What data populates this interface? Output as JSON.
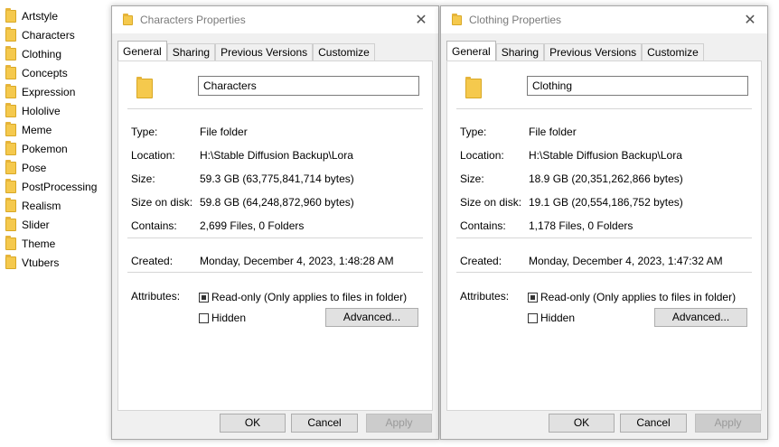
{
  "sidebar": {
    "items": [
      "Artstyle",
      "Characters",
      "Clothing",
      "Concepts",
      "Expression",
      "Hololive",
      "Meme",
      "Pokemon",
      "Pose",
      "PostProcessing",
      "Realism",
      "Slider",
      "Theme",
      "Vtubers"
    ]
  },
  "dialogs": [
    {
      "title": "Characters Properties",
      "tabs": [
        "General",
        "Sharing",
        "Previous Versions",
        "Customize"
      ],
      "name": "Characters",
      "type_label": "Type:",
      "type": "File folder",
      "location_label": "Location:",
      "location": "H:\\Stable Diffusion Backup\\Lora",
      "size_label": "Size:",
      "size": "59.3 GB (63,775,841,714 bytes)",
      "size_on_disk_label": "Size on disk:",
      "size_on_disk": "59.8 GB (64,248,872,960 bytes)",
      "contains_label": "Contains:",
      "contains": "2,699 Files, 0 Folders",
      "created_label": "Created:",
      "created": "Monday, December 4, 2023, 1:48:28 AM",
      "attributes_label": "Attributes:",
      "readonly_label": "Read-only (Only applies to files in folder)",
      "hidden_label": "Hidden",
      "advanced_label": "Advanced...",
      "ok_label": "OK",
      "cancel_label": "Cancel",
      "apply_label": "Apply"
    },
    {
      "title": "Clothing Properties",
      "tabs": [
        "General",
        "Sharing",
        "Previous Versions",
        "Customize"
      ],
      "name": "Clothing",
      "type_label": "Type:",
      "type": "File folder",
      "location_label": "Location:",
      "location": "H:\\Stable Diffusion Backup\\Lora",
      "size_label": "Size:",
      "size": "18.9 GB (20,351,262,866 bytes)",
      "size_on_disk_label": "Size on disk:",
      "size_on_disk": "19.1 GB (20,554,186,752 bytes)",
      "contains_label": "Contains:",
      "contains": "1,178 Files, 0 Folders",
      "created_label": "Created:",
      "created": "Monday, December 4, 2023, 1:47:32 AM",
      "attributes_label": "Attributes:",
      "readonly_label": "Read-only (Only applies to files in folder)",
      "hidden_label": "Hidden",
      "advanced_label": "Advanced...",
      "ok_label": "OK",
      "cancel_label": "Cancel",
      "apply_label": "Apply"
    }
  ],
  "colors": {
    "folder": "#f5c94d",
    "dialog_bg": "#f0f0f0",
    "button": "#e1e1e1",
    "title_text": "#7a7a7a"
  },
  "icons": {
    "folder": "folder-icon",
    "close": "close-icon"
  }
}
